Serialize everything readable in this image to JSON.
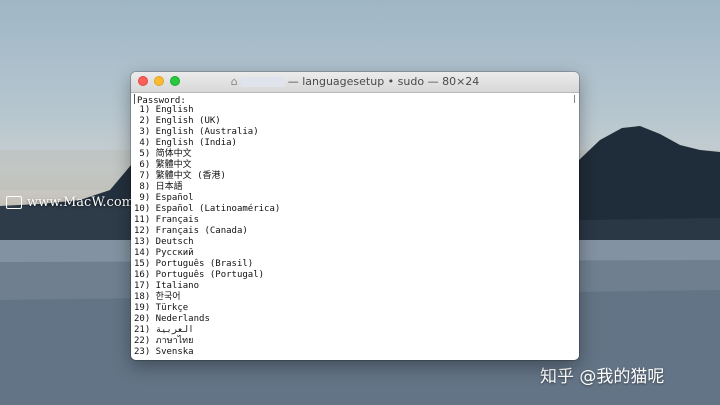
{
  "watermarks": {
    "macw_text": "www.MacW.com",
    "zhihu_text": "知乎 @我的猫呢"
  },
  "terminal": {
    "title_suffix": "— languagesetup • sudo — 80×24",
    "prompt": "Password:",
    "options": [
      " 1) English",
      " 2) English (UK)",
      " 3) English (Australia)",
      " 4) English (India)",
      " 5) 简体中文",
      " 6) 繁體中文",
      " 7) 繁體中文 (香港)",
      " 8) 日本語",
      " 9) Español",
      "10) Español (Latinoamérica)",
      "11) Français",
      "12) Français (Canada)",
      "13) Deutsch",
      "14) Русский",
      "15) Português (Brasil)",
      "16) Português (Portugal)",
      "17) Italiano",
      "18) 한국어",
      "19) Türkçe",
      "20) Nederlands",
      "21) العربية",
      "22) ภาษาไทย",
      "23) Svenska"
    ]
  },
  "icons": {
    "close": "close-button",
    "minimize": "minimize-button",
    "maximize": "zoom-button",
    "title": "home-folder-icon"
  },
  "colors": {
    "close": "#fc5f57",
    "minimize": "#fdbc2e",
    "maximize": "#28c840"
  }
}
